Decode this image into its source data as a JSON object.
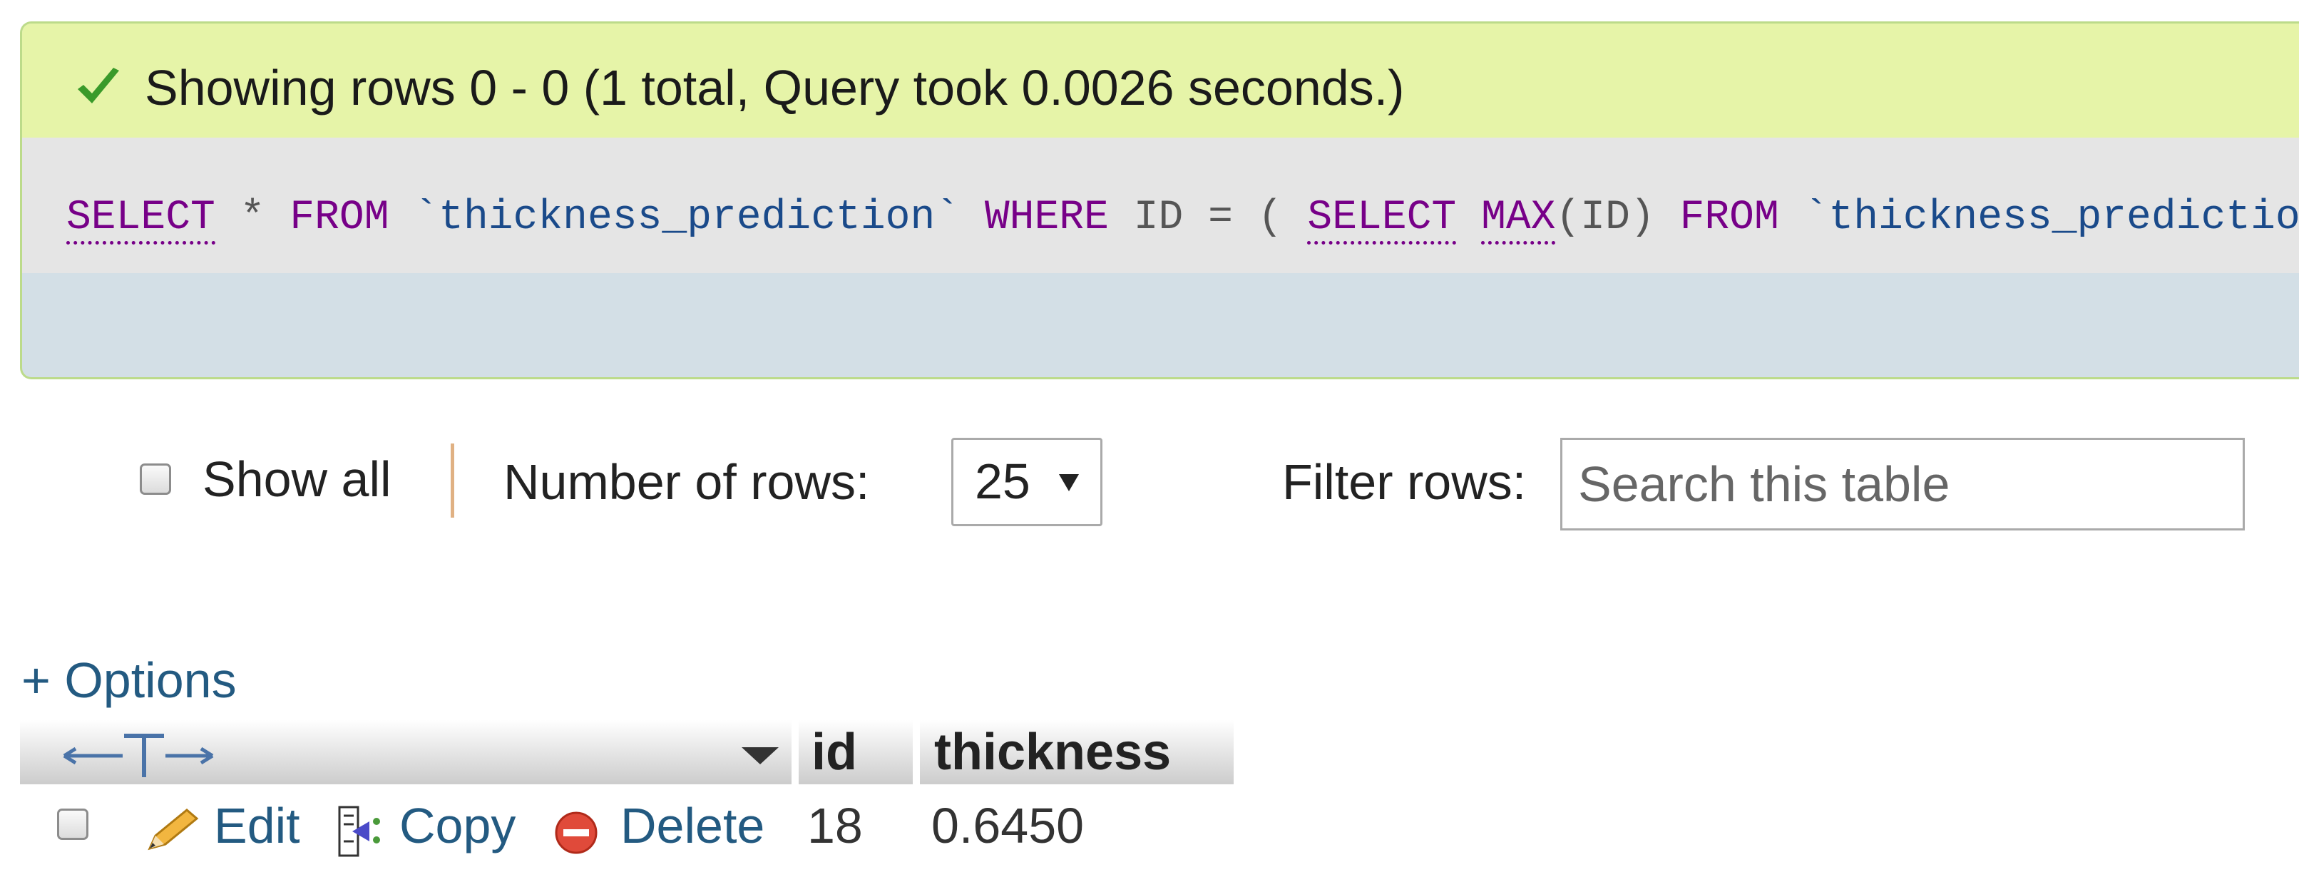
{
  "result": {
    "message": "Showing rows 0 - 0 (1 total, Query took 0.0026 seconds.)",
    "status_color": "#e6f4a8"
  },
  "sql": {
    "select1": "SELECT",
    "star": "*",
    "from1": "FROM",
    "table1": "`thickness_prediction`",
    "where": "WHERE",
    "column": "ID",
    "equals": "=",
    "open_paren": "(",
    "select2": "SELECT",
    "max": "MAX",
    "max_arg": "(ID)",
    "from2": "FROM",
    "table2": "`thickness_prediction`)"
  },
  "controls": {
    "show_all_label": "Show all",
    "number_of_rows_label": "Number of rows:",
    "rows_selected": "25",
    "filter_label": "Filter rows:",
    "filter_placeholder": "Search this table"
  },
  "table": {
    "options_link": "+ Options",
    "headers": [
      "id",
      "thickness"
    ],
    "row_actions": {
      "edit": "Edit",
      "copy": "Copy",
      "delete": "Delete"
    },
    "rows": [
      {
        "id": "18",
        "thickness": "0.6450"
      }
    ]
  },
  "icons": [
    "check-icon",
    "column-resize-icon",
    "sort-arrow-icon",
    "pencil-icon",
    "copy-icon",
    "delete-icon"
  ]
}
